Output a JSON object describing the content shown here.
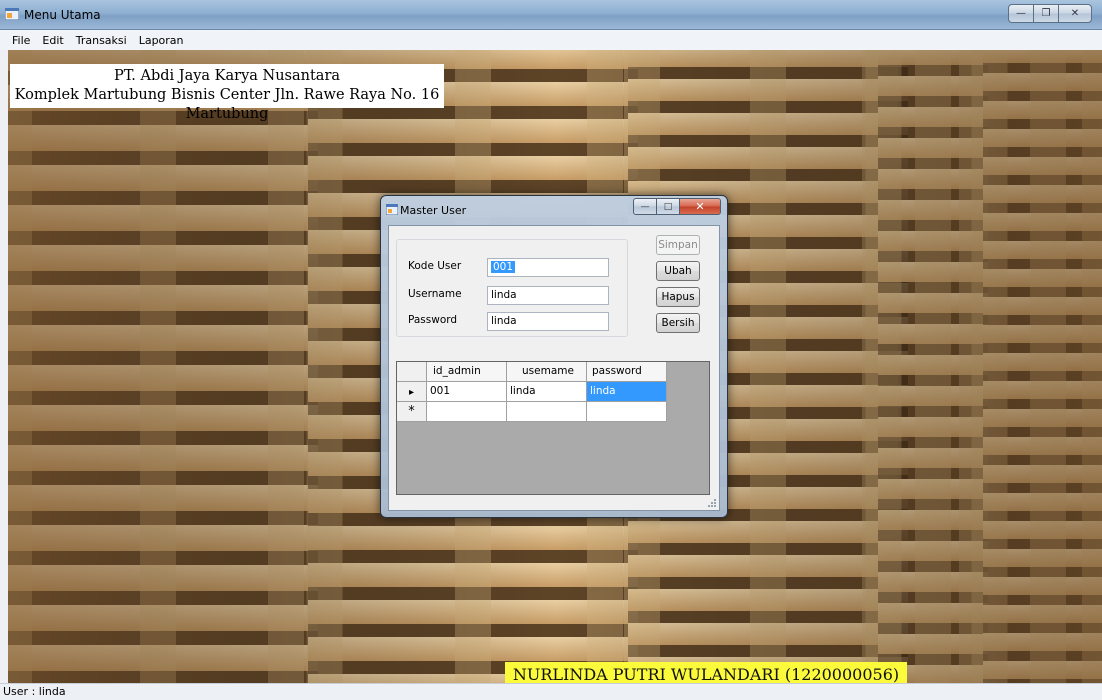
{
  "window": {
    "title": "Menu Utama"
  },
  "menu": [
    {
      "label": "File"
    },
    {
      "label": "Edit"
    },
    {
      "label": "Transaksi"
    },
    {
      "label": "Laporan"
    }
  ],
  "company": {
    "name": "PT. Abdi Jaya Karya Nusantara",
    "address": "Komplek Martubung Bisnis Center Jln. Rawe Raya No. 16 Martubung"
  },
  "author": "NURLINDA PUTRI WULANDARI (1220000056)",
  "statusbar": {
    "text": "User : linda"
  },
  "dialog": {
    "title": "Master User",
    "fields": {
      "kode_user": {
        "label": "Kode User",
        "value": "001"
      },
      "username": {
        "label": "Username",
        "value": "linda"
      },
      "password": {
        "label": "Password",
        "value": "linda"
      }
    },
    "buttons": {
      "simpan": "Simpan",
      "ubah": "Ubah",
      "hapus": "Hapus",
      "bersih": "Bersih"
    },
    "grid": {
      "columns": [
        "id_admin",
        "usemame",
        "password"
      ],
      "rows": [
        {
          "id_admin": "001",
          "username": "linda",
          "password": "linda"
        }
      ],
      "new_row_marker": "*",
      "current_row_marker": "▸"
    }
  },
  "colors": {
    "selection": "#3399ff",
    "author_bg": "#fbfa3b"
  }
}
